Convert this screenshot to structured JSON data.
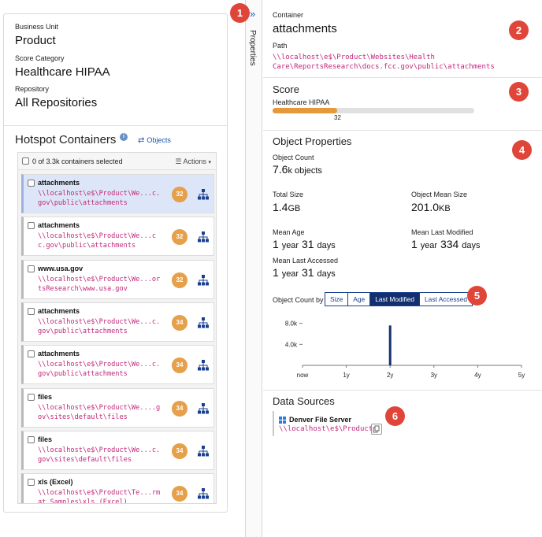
{
  "left": {
    "business_unit_label": "Business Unit",
    "business_unit_value": "Product",
    "score_category_label": "Score Category",
    "score_category_value": "Healthcare HIPAA",
    "repository_label": "Repository",
    "repository_value": "All Repositories",
    "hotspot_title": "Hotspot Containers",
    "info_icon": "i",
    "objects_link_label": "Objects",
    "selected_count": "0 of 3.3k containers selected",
    "actions_label": "Actions",
    "items": [
      {
        "name": "attachments",
        "path": "\\\\localhost\\e$\\Product\\We...c.gov\\public\\attachments",
        "score": "32",
        "selected": true
      },
      {
        "name": "attachments",
        "path": "\\\\localhost\\e$\\Product\\We...cc.gov\\public\\attachments",
        "score": "32",
        "selected": false
      },
      {
        "name": "www.usa.gov",
        "path": "\\\\localhost\\e$\\Product\\We...ortsResearch\\www.usa.gov",
        "score": "32",
        "selected": false
      },
      {
        "name": "attachments",
        "path": "\\\\localhost\\e$\\Product\\We...c.gov\\public\\attachments",
        "score": "34",
        "selected": false
      },
      {
        "name": "attachments",
        "path": "\\\\localhost\\e$\\Product\\We...c.gov\\public\\attachments",
        "score": "34",
        "selected": false
      },
      {
        "name": "files",
        "path": "\\\\localhost\\e$\\Product\\We....gov\\sites\\default\\files",
        "score": "34",
        "selected": false
      },
      {
        "name": "files",
        "path": "\\\\localhost\\e$\\Product\\We...c.gov\\sites\\default\\files",
        "score": "34",
        "selected": false
      },
      {
        "name": "xls (Excel)",
        "path": "\\\\localhost\\e$\\Product\\Te...rmat Samples\\xls (Excel)",
        "score": "34",
        "selected": false
      }
    ]
  },
  "collapse": {
    "icon": "double-chevron-right-icon",
    "glyph": "»",
    "label": "Properties"
  },
  "right": {
    "container_label": "Container",
    "container_value": "attachments",
    "path_label": "Path",
    "path_value": "\\\\localhost\\e$\\Product\\Websites\\Health Care\\ReportsResearch\\docs.fcc.gov\\public\\attachments",
    "score_title": "Score",
    "score_category": "Healthcare HIPAA",
    "score_value": "32",
    "score_fraction": 0.32,
    "score_color": "#e5993a",
    "object_properties_title": "Object Properties",
    "object_count_label": "Object Count",
    "object_count_num": "7.6",
    "object_count_unit": "k objects",
    "total_size_label": "Total Size",
    "total_size_num": "1.4",
    "total_size_unit": "GB",
    "mean_size_label": "Object Mean Size",
    "mean_size_num": "201.0",
    "mean_size_unit": "KB",
    "mean_age_label": "Mean Age",
    "mean_age_year": "1",
    "mean_age_year_unit": "year",
    "mean_age_days": "31",
    "mean_age_days_unit": "days",
    "mean_mod_label": "Mean Last Modified",
    "mean_mod_year": "1",
    "mean_mod_year_unit": "year",
    "mean_mod_days": "334",
    "mean_mod_days_unit": "days",
    "mean_acc_label": "Mean Last Accessed",
    "mean_acc_year": "1",
    "mean_acc_year_unit": "year",
    "mean_acc_days": "31",
    "mean_acc_days_unit": "days",
    "count_by_label": "Object Count by",
    "segments": [
      "Size",
      "Age",
      "Last Modified",
      "Last Accessed"
    ],
    "active_segment": 2,
    "data_sources_title": "Data Sources",
    "ds_name": "Denver File Server",
    "ds_path": "\\\\localhost\\e$\\Product"
  },
  "callouts": [
    "1",
    "2",
    "3",
    "4",
    "5",
    "6"
  ],
  "chart_data": {
    "type": "bar",
    "x_ticks": [
      "now",
      "1y",
      "2y",
      "3y",
      "4y",
      "5y"
    ],
    "y_ticks": [
      "8.0k",
      "4.0k"
    ],
    "ylim": [
      0,
      9600
    ],
    "bars": [
      {
        "x_years": 2.0,
        "value": 7600
      }
    ],
    "bar_color": "#142f6e"
  }
}
